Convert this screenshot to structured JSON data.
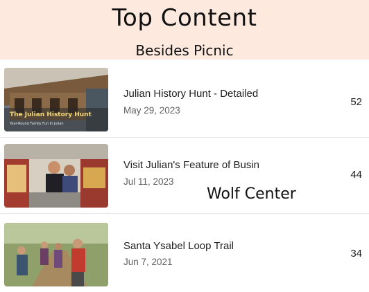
{
  "banner": {
    "title": "Top Content",
    "subtitle": "Besides Picnic"
  },
  "videos": [
    {
      "title": "Julian History Hunt - Detailed",
      "date": "May 29, 2023",
      "count": "52",
      "thumb_caption": "The Julian History Hunt",
      "thumb_caption_small": "Year-Round Family Fun In Julian"
    },
    {
      "title": "Visit Julian's Feature of Busin",
      "date": "Jul 11, 2023",
      "count": "44"
    },
    {
      "title": "Santa Ysabel Loop Trail",
      "date": "Jun 7, 2021",
      "count": "34"
    }
  ],
  "overlay_label": "Wolf Center",
  "colors": {
    "banner_bg": "#fde9dd",
    "row_divider": "#e7e7e7"
  }
}
